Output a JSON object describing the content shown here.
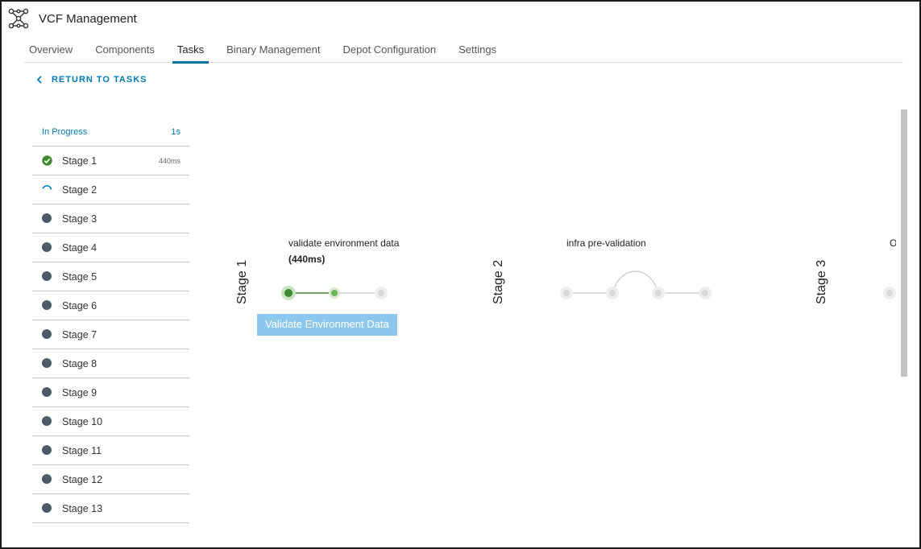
{
  "app": {
    "title": "VCF Management",
    "logo_icon": "network-nodes-icon"
  },
  "tabs": [
    {
      "label": "Overview",
      "active": false
    },
    {
      "label": "Components",
      "active": false
    },
    {
      "label": "Tasks",
      "active": true
    },
    {
      "label": "Binary Management",
      "active": false
    },
    {
      "label": "Depot Configuration",
      "active": false
    },
    {
      "label": "Settings",
      "active": false
    }
  ],
  "return_link": {
    "label": "RETURN TO TASKS",
    "icon": "chevron-left-icon"
  },
  "sidebar": {
    "status": "In Progress",
    "duration": "1s",
    "stages": [
      {
        "label": "Stage 1",
        "state": "complete",
        "time": "440ms"
      },
      {
        "label": "Stage 2",
        "state": "running",
        "time": ""
      },
      {
        "label": "Stage 3",
        "state": "pending",
        "time": ""
      },
      {
        "label": "Stage 4",
        "state": "pending",
        "time": ""
      },
      {
        "label": "Stage 5",
        "state": "pending",
        "time": ""
      },
      {
        "label": "Stage 6",
        "state": "pending",
        "time": ""
      },
      {
        "label": "Stage 7",
        "state": "pending",
        "time": ""
      },
      {
        "label": "Stage 8",
        "state": "pending",
        "time": ""
      },
      {
        "label": "Stage 9",
        "state": "pending",
        "time": ""
      },
      {
        "label": "Stage 10",
        "state": "pending",
        "time": ""
      },
      {
        "label": "Stage 11",
        "state": "pending",
        "time": ""
      },
      {
        "label": "Stage 12",
        "state": "pending",
        "time": ""
      },
      {
        "label": "Stage 13",
        "state": "pending",
        "time": ""
      }
    ]
  },
  "flow": {
    "stage1": {
      "label": "Stage 1",
      "task_title": "validate environment data",
      "task_time": "(440ms)",
      "tooltip": "Validate Environment Data"
    },
    "stage2": {
      "label": "Stage 2",
      "task_title": "infra pre-validation"
    },
    "stage3": {
      "label": "Stage 3",
      "task_title": "Op"
    }
  },
  "colors": {
    "accent": "#0079b8",
    "success": "#3c8a2e",
    "pending": "#4a5a66",
    "tooltip": "#8cc8ee"
  }
}
